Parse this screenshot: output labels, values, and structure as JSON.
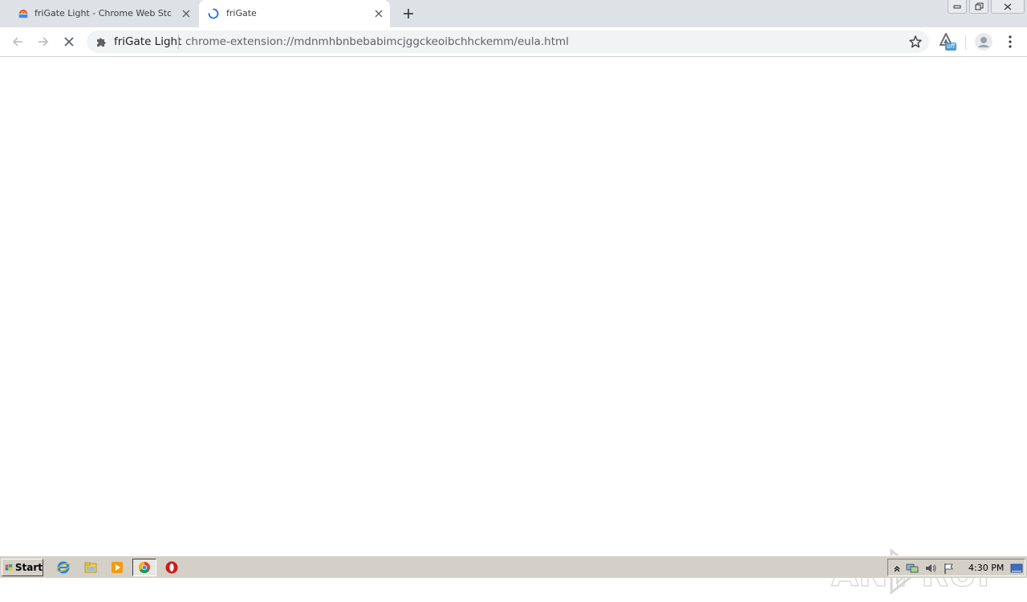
{
  "tabs": [
    {
      "title": "friGate Light - Chrome Web Store",
      "active": false
    },
    {
      "title": "friGate",
      "active": true
    }
  ],
  "omnibox": {
    "origin": "friGate Light",
    "url": "chrome-extension://mdnmhbnbebabimcjggckeoibchhckemm/eula.html"
  },
  "extension_badge": "off",
  "watermark": {
    "left": "ANY",
    "right": "RUN"
  },
  "taskbar": {
    "start_label": "Start",
    "clock": "4:30 PM"
  },
  "colors": {
    "tabstrip": "#dee1e6",
    "omnibox": "#f1f3f4",
    "taskbar": "#d4d0c8",
    "badge": "#4a9bd1"
  }
}
